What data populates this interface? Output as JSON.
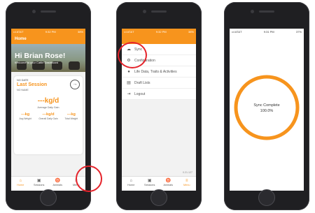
{
  "colors": {
    "accent": "#f7941d",
    "annotation": "#e5232b"
  },
  "phone1": {
    "status": {
      "carrier": "••l AT&T",
      "time": "9:32 PM",
      "battery": "38%"
    },
    "appbar_title": "Home",
    "greeting": "Hi Brian Rose!",
    "welcome": "Welcome to your Cattle Dashboard",
    "card": {
      "date": "NO DATE",
      "session_title": "Last Session",
      "name": "NO NAME",
      "daily_gain": "---kg/d",
      "daily_gain_label": "Average Daily Gain",
      "stats": [
        {
          "value": "---kg",
          "label": "Avg Weight"
        },
        {
          "value": "---kg/d",
          "label": "Overall Daily Gain"
        },
        {
          "value": "---kg",
          "label": "Total Weight"
        }
      ]
    },
    "tabs": [
      {
        "label": "Home",
        "icon": "home-icon"
      },
      {
        "label": "Sessions",
        "icon": "clipboard-icon"
      },
      {
        "label": "Animals",
        "icon": "cow-icon"
      },
      {
        "label": "Menu",
        "icon": "menu-icon"
      }
    ]
  },
  "phone2": {
    "status": {
      "carrier": "••l AT&T",
      "time": "9:32 PM",
      "battery": "38%"
    },
    "menu": [
      {
        "label": "Sync",
        "icon": "cloud-icon"
      },
      {
        "label": "Configuration",
        "icon": "gear-icon"
      },
      {
        "label": "Life Data, Traits & Activities",
        "icon": "info-icon"
      },
      {
        "label": "Draft Lists",
        "icon": "list-icon"
      },
      {
        "label": "Logout",
        "icon": "logout-icon"
      }
    ],
    "version": "0.21.127",
    "tabs": [
      {
        "label": "Home",
        "icon": "home-icon"
      },
      {
        "label": "Sessions",
        "icon": "clipboard-icon"
      },
      {
        "label": "Animals",
        "icon": "cow-icon"
      },
      {
        "label": "Menu",
        "icon": "menu-icon"
      }
    ]
  },
  "phone3": {
    "status": {
      "carrier": "••l AT&T",
      "time": "9:31 PM",
      "battery": "37%"
    },
    "sync_title": "Sync Complete",
    "sync_percent": "100.0%",
    "progress": 1.0
  }
}
